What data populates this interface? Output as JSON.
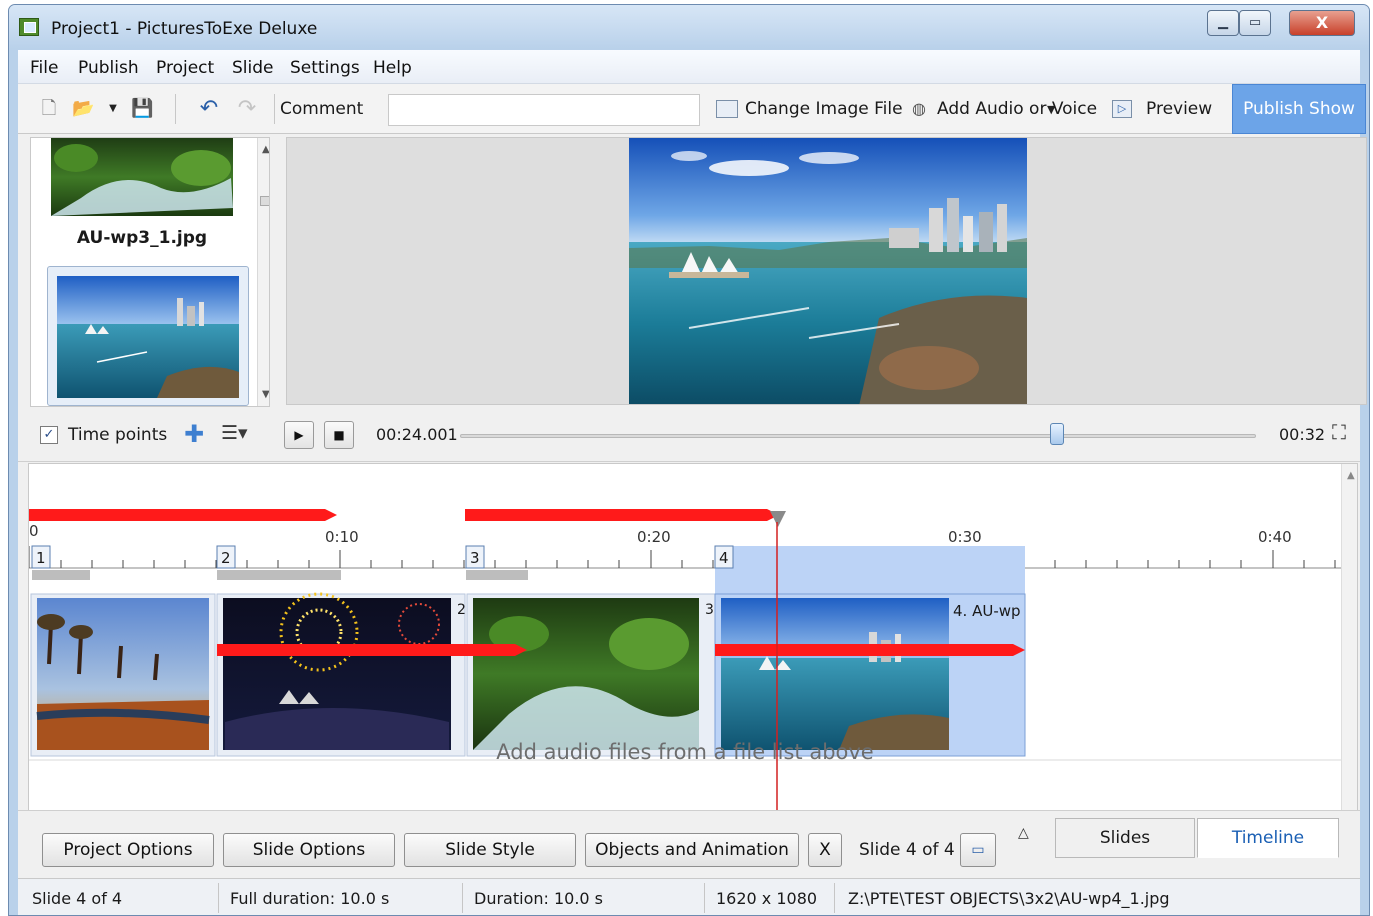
{
  "window": {
    "title": "Project1 - PicturesToExe Deluxe",
    "controls": {
      "minimize": "▁",
      "maximize": "▭",
      "close": "X"
    }
  },
  "menu": [
    "File",
    "Publish",
    "Project",
    "Slide",
    "Settings",
    "Help"
  ],
  "toolbar": {
    "comment_label": "Comment",
    "comment_value": "",
    "change_image": "Change Image File",
    "add_audio": "Add Audio or Voice",
    "preview": "Preview",
    "publish": "Publish Show"
  },
  "thumbnails": [
    {
      "filename": "AU-wp3_1.jpg"
    }
  ],
  "playback": {
    "time_points_label": "Time points",
    "time_points_checked": true,
    "current_time": "00:24.001",
    "total_time": "00:32",
    "position_fraction": 0.75
  },
  "timeline": {
    "ruler_labels": [
      "0",
      "0:10",
      "0:20",
      "0:30",
      "0:40"
    ],
    "slides": [
      {
        "number": "1",
        "corner_label": ""
      },
      {
        "number": "2",
        "corner_label": "2"
      },
      {
        "number": "3",
        "corner_label": "3"
      },
      {
        "number": "4",
        "corner_label": "4. AU-wp"
      }
    ],
    "audio_hint": "Add audio files from a file list above"
  },
  "bottom": {
    "project_options": "Project Options",
    "slide_options": "Slide Options",
    "slide_style": "Slide Style",
    "objects_animation": "Objects and Animation",
    "close_x": "X",
    "slide_count": "Slide 4 of 4",
    "tab_slides": "Slides",
    "tab_timeline": "Timeline"
  },
  "status": {
    "slide": "Slide 4 of 4",
    "full_duration": "Full duration: 10.0 s",
    "duration": "Duration: 10.0 s",
    "resolution": "1620 x 1080",
    "path": "Z:\\PTE\\TEST OBJECTS\\3x2\\AU-wp4_1.jpg"
  },
  "colors": {
    "accent": "#6ca4e8",
    "marker_red": "#ff1a1a",
    "selection": "#bcd3f6"
  }
}
